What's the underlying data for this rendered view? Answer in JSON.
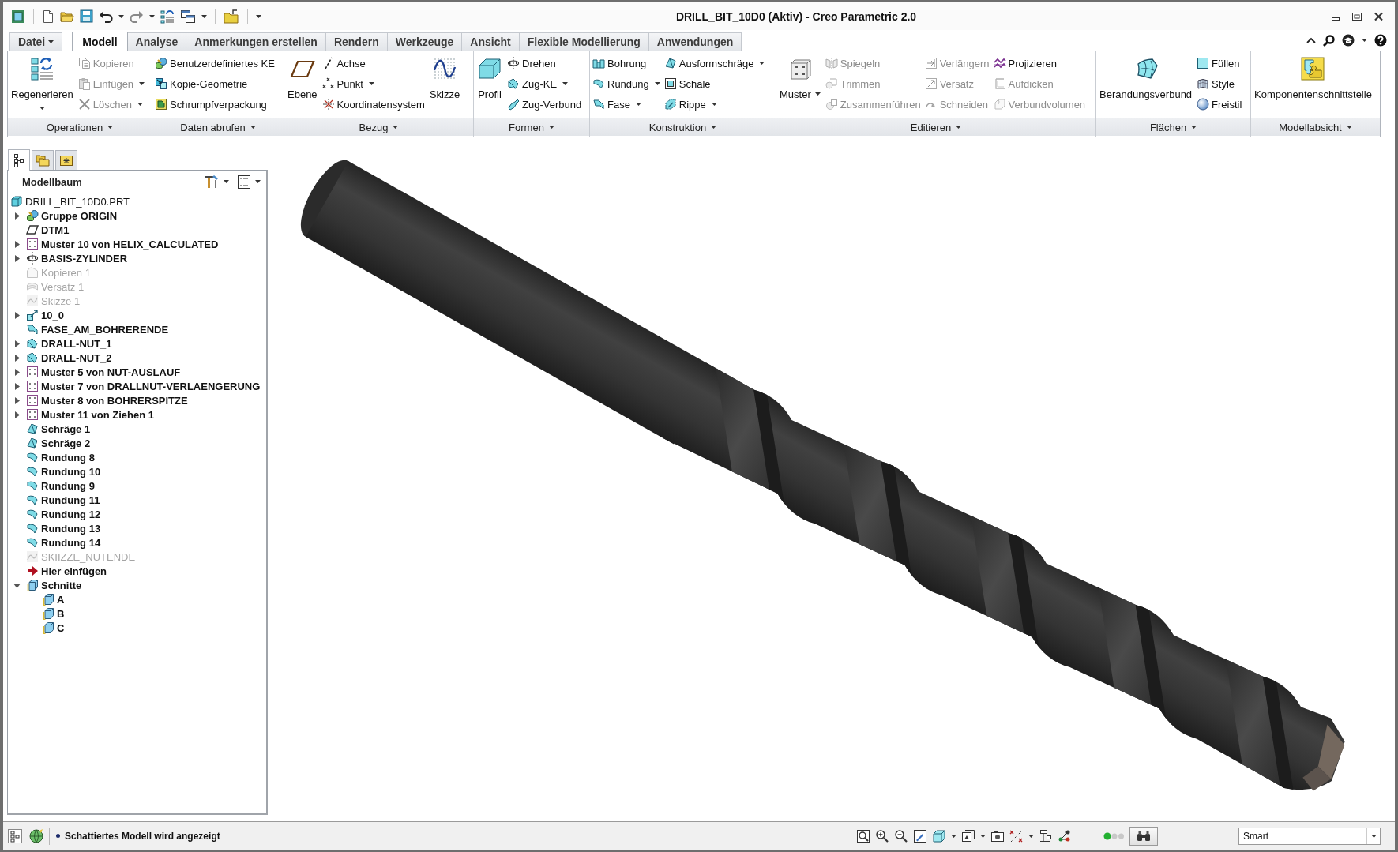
{
  "window": {
    "title": "DRILL_BIT_10D0 (Aktiv) - Creo Parametric 2.0"
  },
  "ribbon": {
    "tabs": [
      {
        "label": "Datei",
        "kind": "menu",
        "selected": false
      },
      {
        "label": "Modell",
        "kind": "tab",
        "selected": true
      },
      {
        "label": "Analyse",
        "kind": "tab",
        "selected": false
      },
      {
        "label": "Anmerkungen erstellen",
        "kind": "tab",
        "selected": false
      },
      {
        "label": "Rendern",
        "kind": "tab",
        "selected": false
      },
      {
        "label": "Werkzeuge",
        "kind": "tab",
        "selected": false
      },
      {
        "label": "Ansicht",
        "kind": "tab",
        "selected": false
      },
      {
        "label": "Flexible Modellierung",
        "kind": "tab",
        "selected": false
      },
      {
        "label": "Anwendungen",
        "kind": "tab",
        "selected": false
      }
    ],
    "groups": [
      {
        "label": "Operationen",
        "items": [
          {
            "kind": "split",
            "label": "Regenerieren",
            "disabled": false,
            "dropdown": true
          },
          {
            "kind": "small",
            "label": "Kopieren",
            "disabled": true,
            "dropdown": false
          },
          {
            "kind": "small",
            "label": "Einfügen",
            "disabled": true,
            "dropdown": true
          },
          {
            "kind": "small",
            "label": "Löschen",
            "disabled": true,
            "dropdown": true
          }
        ]
      },
      {
        "label": "Daten abrufen",
        "items": [
          {
            "kind": "small",
            "label": "Benutzerdefiniertes KE",
            "disabled": false,
            "dropdown": false
          },
          {
            "kind": "small",
            "label": "Kopie-Geometrie",
            "disabled": false,
            "dropdown": false
          },
          {
            "kind": "small",
            "label": "Schrumpfverpackung",
            "disabled": false,
            "dropdown": false
          }
        ]
      },
      {
        "label": "Bezug",
        "items": [
          {
            "kind": "large",
            "label": "Ebene",
            "disabled": false,
            "dropdown": false
          },
          {
            "kind": "small",
            "label": "Achse",
            "disabled": false,
            "dropdown": false
          },
          {
            "kind": "small",
            "label": "Punkt",
            "disabled": false,
            "dropdown": true
          },
          {
            "kind": "small",
            "label": "Koordinatensystem",
            "disabled": false,
            "dropdown": false
          },
          {
            "kind": "large",
            "label": "Skizze",
            "disabled": false,
            "dropdown": false
          }
        ]
      },
      {
        "label": "Formen",
        "items": [
          {
            "kind": "large",
            "label": "Profil",
            "disabled": false,
            "dropdown": false
          },
          {
            "kind": "small",
            "label": "Drehen",
            "disabled": false,
            "dropdown": false
          },
          {
            "kind": "small",
            "label": "Zug-KE",
            "disabled": false,
            "dropdown": true
          },
          {
            "kind": "small",
            "label": "Zug-Verbund",
            "disabled": false,
            "dropdown": false
          }
        ]
      },
      {
        "label": "Konstruktion",
        "items": [
          {
            "kind": "small",
            "label": "Bohrung",
            "disabled": false,
            "dropdown": false
          },
          {
            "kind": "small",
            "label": "Rundung",
            "disabled": false,
            "dropdown": true
          },
          {
            "kind": "small",
            "label": "Fase",
            "disabled": false,
            "dropdown": true
          },
          {
            "kind": "small",
            "label": "Ausformschräge",
            "disabled": false,
            "dropdown": true
          },
          {
            "kind": "small",
            "label": "Schale",
            "disabled": false,
            "dropdown": false
          },
          {
            "kind": "small",
            "label": "Rippe",
            "disabled": false,
            "dropdown": true
          }
        ]
      },
      {
        "label": "Editieren",
        "items": [
          {
            "kind": "large",
            "label": "Muster",
            "disabled": false,
            "dropdown": true
          },
          {
            "kind": "small",
            "label": "Spiegeln",
            "disabled": true,
            "dropdown": false
          },
          {
            "kind": "small",
            "label": "Trimmen",
            "disabled": true,
            "dropdown": false
          },
          {
            "kind": "small",
            "label": "Zusammenführen",
            "disabled": true,
            "dropdown": false
          },
          {
            "kind": "small",
            "label": "Verlängern",
            "disabled": true,
            "dropdown": false
          },
          {
            "kind": "small",
            "label": "Versatz",
            "disabled": true,
            "dropdown": false
          },
          {
            "kind": "small",
            "label": "Schneiden",
            "disabled": true,
            "dropdown": false
          },
          {
            "kind": "small",
            "label": "Projizieren",
            "disabled": false,
            "dropdown": false
          },
          {
            "kind": "small",
            "label": "Aufdicken",
            "disabled": true,
            "dropdown": false
          },
          {
            "kind": "small",
            "label": "Verbundvolumen",
            "disabled": true,
            "dropdown": false
          }
        ]
      },
      {
        "label": "Flächen",
        "items": [
          {
            "kind": "large",
            "label": "Berandungsverbund",
            "disabled": false,
            "dropdown": false
          },
          {
            "kind": "small",
            "label": "Füllen",
            "disabled": false,
            "dropdown": false
          },
          {
            "kind": "small",
            "label": "Style",
            "disabled": false,
            "dropdown": false
          },
          {
            "kind": "small",
            "label": "Freistil",
            "disabled": false,
            "dropdown": false
          }
        ]
      },
      {
        "label": "Modellabsicht",
        "items": [
          {
            "kind": "large",
            "label": "Komponentenschnittstelle",
            "disabled": false,
            "dropdown": false
          }
        ]
      }
    ]
  },
  "model_tree": {
    "navigator_tabs": [
      {
        "selected": true
      },
      {
        "selected": false
      },
      {
        "selected": false
      }
    ],
    "title": "Modellbaum",
    "items": [
      {
        "label": "DRILL_BIT_10D0.PRT",
        "kind": "part",
        "disabled": false,
        "children": [
          {
            "label": "Gruppe ORIGIN",
            "kind": "group",
            "disabled": false,
            "expanded": false
          },
          {
            "label": "DTM1",
            "kind": "datum",
            "disabled": false
          },
          {
            "label": "Muster 10 von HELIX_CALCULATED",
            "kind": "pattern",
            "disabled": false,
            "expanded": false
          },
          {
            "label": "BASIS-ZYLINDER",
            "kind": "revolve",
            "disabled": false,
            "expanded": false
          },
          {
            "label": "Kopieren 1",
            "kind": "copy",
            "disabled": true
          },
          {
            "label": "Versatz 1",
            "kind": "offset",
            "disabled": true
          },
          {
            "label": "Skizze 1",
            "kind": "sketch",
            "disabled": true
          },
          {
            "label": "10_0",
            "kind": "udf",
            "disabled": false,
            "expanded": false
          },
          {
            "label": "FASE_AM_BOHRERENDE",
            "kind": "chamfer",
            "disabled": false
          },
          {
            "label": "DRALL-NUT_1",
            "kind": "sweep",
            "disabled": false,
            "expanded": false
          },
          {
            "label": "DRALL-NUT_2",
            "kind": "sweep",
            "disabled": false,
            "expanded": false
          },
          {
            "label": "Muster 5 von NUT-AUSLAUF",
            "kind": "pattern",
            "disabled": false,
            "expanded": false
          },
          {
            "label": "Muster 7 von DRALLNUT-VERLAENGERUNG",
            "kind": "pattern",
            "disabled": false,
            "expanded": false
          },
          {
            "label": "Muster 8 von BOHRERSPITZE",
            "kind": "pattern",
            "disabled": false,
            "expanded": false
          },
          {
            "label": "Muster 11 von Ziehen 1",
            "kind": "pattern",
            "disabled": false,
            "expanded": false
          },
          {
            "label": "Schräge 1",
            "kind": "draft",
            "disabled": false
          },
          {
            "label": "Schräge 2",
            "kind": "draft",
            "disabled": false
          },
          {
            "label": "Rundung 8",
            "kind": "round",
            "disabled": false
          },
          {
            "label": "Rundung 10",
            "kind": "round",
            "disabled": false
          },
          {
            "label": "Rundung 9",
            "kind": "round",
            "disabled": false
          },
          {
            "label": "Rundung 11",
            "kind": "round",
            "disabled": false
          },
          {
            "label": "Rundung 12",
            "kind": "round",
            "disabled": false
          },
          {
            "label": "Rundung 13",
            "kind": "round",
            "disabled": false
          },
          {
            "label": "Rundung 14",
            "kind": "round",
            "disabled": false
          },
          {
            "label": "SKIIZZE_NUTENDE",
            "kind": "sketch",
            "disabled": true
          },
          {
            "label": "Hier einfügen",
            "kind": "insert",
            "disabled": false
          },
          {
            "label": "Schnitte",
            "kind": "folder",
            "disabled": false,
            "expanded": true,
            "children": [
              {
                "label": "A",
                "kind": "section",
                "disabled": false
              },
              {
                "label": "B",
                "kind": "section",
                "disabled": false
              },
              {
                "label": "C",
                "kind": "section",
                "disabled": false
              }
            ]
          }
        ]
      }
    ]
  },
  "status_bar": {
    "message": "Schattiertes Modell wird angezeigt",
    "filter": "Smart"
  }
}
